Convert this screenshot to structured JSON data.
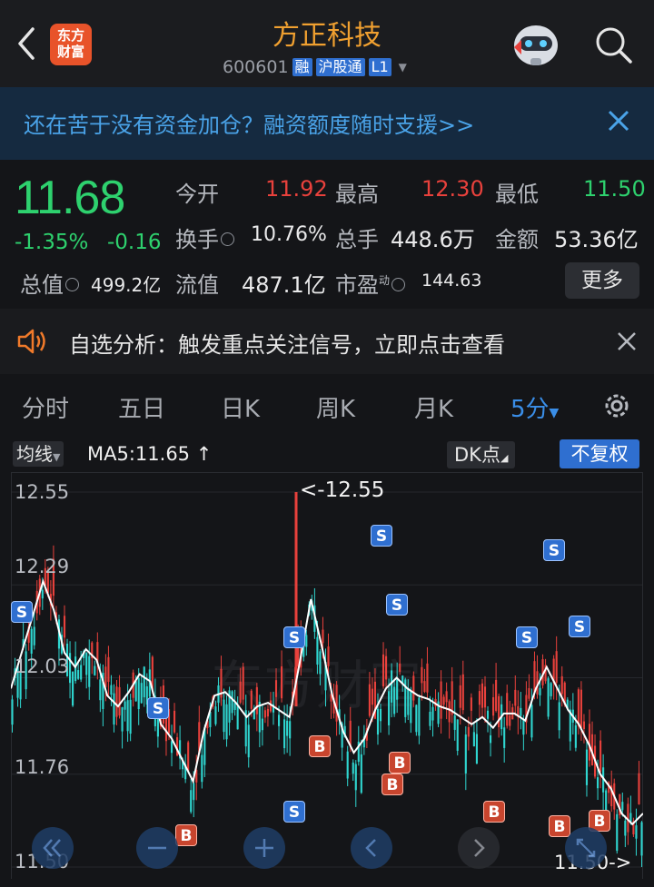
{
  "header": {
    "logo_text": "东方\n财富",
    "title": "方正科技",
    "code": "600601",
    "tags": [
      "融",
      "沪股通",
      "L1"
    ]
  },
  "banner": {
    "text": "还在苦于没有资金加仓？融资额度随时支援>>"
  },
  "quote": {
    "price": "11.68",
    "change_pct": "-1.35%",
    "change": "-0.16",
    "open_label": "今开",
    "open": "11.92",
    "high_label": "最高",
    "high": "12.30",
    "low_label": "最低",
    "low": "11.50",
    "turnover_label": "换手",
    "turnover": "10.76%",
    "volume_label": "总手",
    "volume": "448.6万",
    "amount_label": "金额",
    "amount": "53.36亿",
    "mktcap_label": "总值",
    "mktcap": "499.2亿",
    "float_label": "流值",
    "float": "487.1亿",
    "pe_label": "市盈",
    "pe_sup": "动",
    "pe": "144.63",
    "more_label": "更多"
  },
  "analysis": {
    "text": "自选分析：触发重点关注信号，立即点击查看"
  },
  "tabs": [
    {
      "label": "分时"
    },
    {
      "label": "五日"
    },
    {
      "label": "日K"
    },
    {
      "label": "周K"
    },
    {
      "label": "月K"
    },
    {
      "label": "5分"
    }
  ],
  "chart_toolbar": {
    "ma_label": "均线",
    "ma_value": "MA5:11.65",
    "dk_label": "DK点",
    "fq_label": "不复权"
  },
  "chart_data": {
    "type": "candlestick",
    "y_ticks": [
      "12.55",
      "12.29",
      "12.03",
      "11.76",
      "11.50"
    ],
    "ylim": [
      11.5,
      12.55
    ],
    "high_label": "<-12.55",
    "low_label": "11.50->",
    "watermark": "东方财富",
    "ma5": [
      12.0,
      12.1,
      12.2,
      12.3,
      12.22,
      12.1,
      12.06,
      12.11,
      12.08,
      11.98,
      11.95,
      11.99,
      12.04,
      12.02,
      11.9,
      11.86,
      11.8,
      11.74,
      11.88,
      11.98,
      11.99,
      11.96,
      11.92,
      11.95,
      11.96,
      11.94,
      11.92,
      12.08,
      12.25,
      12.12,
      11.98,
      11.88,
      11.82,
      11.86,
      11.94,
      12.0,
      12.03,
      12.0,
      11.98,
      11.97,
      11.95,
      11.94,
      11.92,
      11.9,
      11.92,
      11.89,
      11.93,
      11.93,
      11.91,
      12.0,
      12.06,
      12.0,
      11.94,
      11.9,
      11.84,
      11.76,
      11.72,
      11.65,
      11.62,
      11.65
    ],
    "signals": [
      {
        "type": "S"
      },
      {
        "type": "S"
      },
      {
        "type": "S"
      },
      {
        "type": "S"
      },
      {
        "type": "S"
      },
      {
        "type": "S"
      },
      {
        "type": "S"
      },
      {
        "type": "S"
      },
      {
        "type": "B"
      },
      {
        "type": "B"
      },
      {
        "type": "B"
      },
      {
        "type": "B"
      },
      {
        "type": "B"
      },
      {
        "type": "B"
      },
      {
        "type": "B"
      }
    ]
  },
  "colors": {
    "up": "#e8413c",
    "down": "#2fd6d0",
    "accent": "#2f6fd0",
    "title": "#f0a030"
  }
}
